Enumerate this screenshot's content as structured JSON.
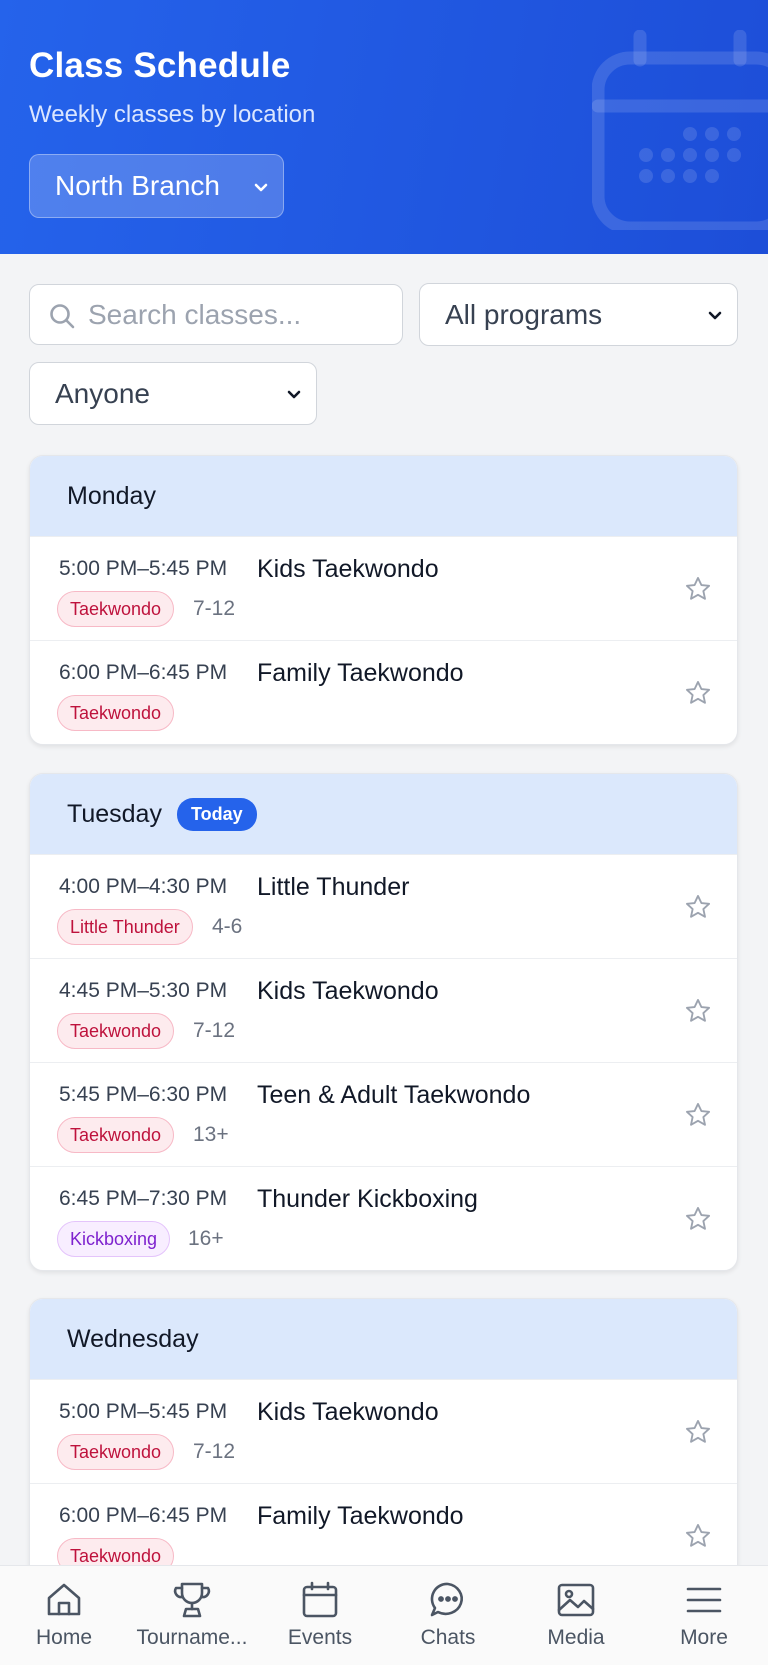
{
  "header": {
    "title": "Class Schedule",
    "subtitle": "Weekly classes by location",
    "branch": "North Branch"
  },
  "filters": {
    "search_placeholder": "Search classes...",
    "program": "All programs",
    "audience": "Anyone"
  },
  "days": [
    {
      "name": "Monday",
      "classes": [
        {
          "time": "5:00 PM–5:45 PM",
          "name": "Kids Taekwondo",
          "tag": "Taekwondo",
          "age": "7-12"
        },
        {
          "time": "6:00 PM–6:45 PM",
          "name": "Family Taekwondo",
          "tag": "Taekwondo"
        }
      ]
    },
    {
      "name": "Tuesday",
      "badge": "Today",
      "classes": [
        {
          "time": "4:00 PM–4:30 PM",
          "name": "Little Thunder",
          "tag": "Little Thunder",
          "age": "4-6"
        },
        {
          "time": "4:45 PM–5:30 PM",
          "name": "Kids Taekwondo",
          "tag": "Taekwondo",
          "age": "7-12"
        },
        {
          "time": "5:45 PM–6:30 PM",
          "name": "Teen & Adult Taekwondo",
          "tag": "Taekwondo",
          "age": "13+"
        },
        {
          "time": "6:45 PM–7:30 PM",
          "name": "Thunder Kickboxing",
          "tag": "Kickboxing",
          "age": "16+"
        }
      ]
    },
    {
      "name": "Wednesday",
      "classes": [
        {
          "time": "5:00 PM–5:45 PM",
          "name": "Kids Taekwondo",
          "tag": "Taekwondo",
          "age": "7-12"
        },
        {
          "time": "6:00 PM–6:45 PM",
          "name": "Family Taekwondo",
          "tag": "Taekwondo"
        }
      ]
    }
  ],
  "nav": [
    {
      "label": "Home",
      "icon": "home-icon"
    },
    {
      "label": "Tourname...",
      "icon": "trophy-icon"
    },
    {
      "label": "Events",
      "icon": "calendar-icon"
    },
    {
      "label": "Chats",
      "icon": "chat-icon"
    },
    {
      "label": "Media",
      "icon": "image-icon"
    },
    {
      "label": "More",
      "icon": "menu-icon"
    }
  ],
  "colors": {
    "header_blue": "#2563eb",
    "day_header": "#dbe8fc",
    "tag_taekwondo": "#be123c",
    "tag_kickboxing": "#7e22ce"
  }
}
